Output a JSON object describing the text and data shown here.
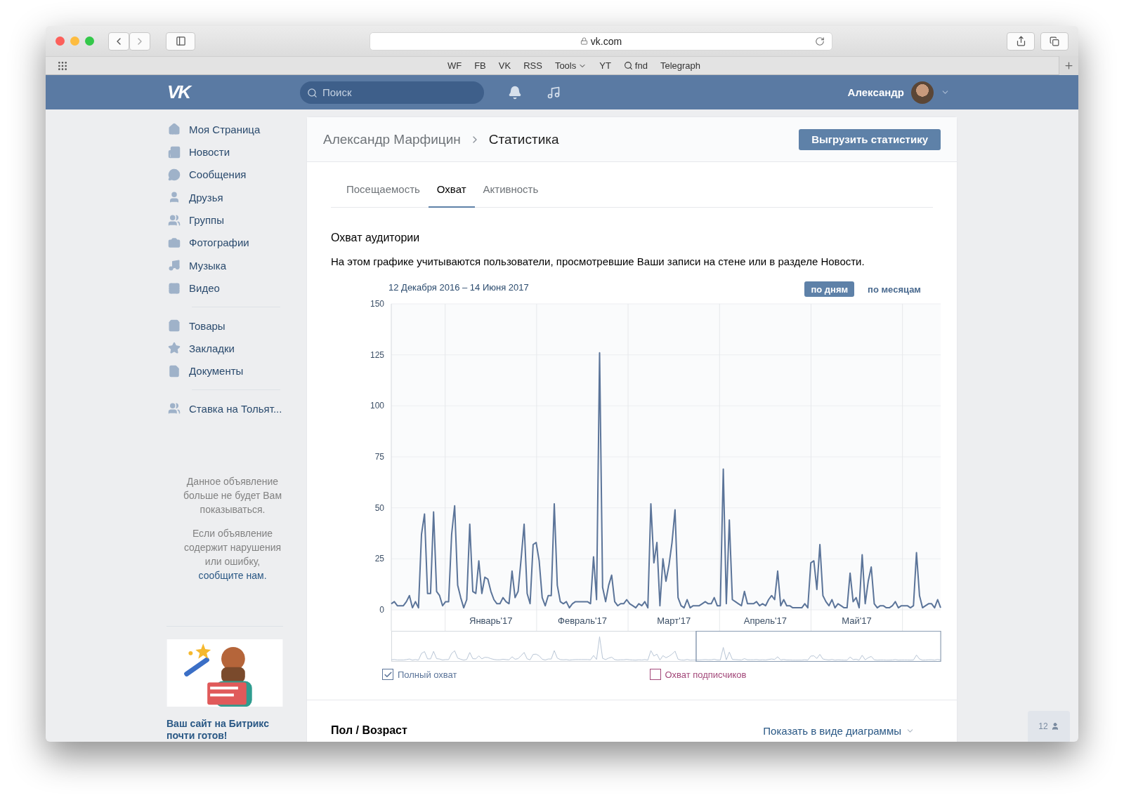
{
  "browser": {
    "address": "vk.com",
    "bookmarks": [
      "WF",
      "FB",
      "VK",
      "RSS",
      "Tools",
      "YT",
      "fnd",
      "Telegraph"
    ]
  },
  "header": {
    "logo": "VK",
    "search": {
      "placeholder": "Поиск"
    },
    "user": "Александр"
  },
  "sidebar": {
    "groups": [
      [
        "Моя Страница",
        "Новости",
        "Сообщения",
        "Друзья",
        "Группы",
        "Фотографии",
        "Музыка",
        "Видео"
      ],
      [
        "Товары",
        "Закладки",
        "Документы"
      ],
      [
        "Ставка на Тольят..."
      ]
    ],
    "notice": [
      "Данное объявление больше не будет Вам показываться.",
      "Если объявление содержит нарушения или ошибку, "
    ],
    "notice_link": "сообщите нам.",
    "ad_title": "Ваш сайт на Битрикс почти готов!"
  },
  "breadcrumb": {
    "parent": "Александр Марфицин",
    "current": "Статистика"
  },
  "export_button": "Выгрузить статистику",
  "tabs": [
    {
      "label": "Посещаемость",
      "selected": false
    },
    {
      "label": "Охват",
      "selected": true
    },
    {
      "label": "Активность",
      "selected": false
    }
  ],
  "section": {
    "title": "Охват аудитории",
    "description": "На этом графике учитываются пользователи, просмотревшие Ваши записи на стене или в разделе Новости.",
    "period": "12 Декабря 2016 – 14 Июня 2017",
    "modes": [
      {
        "label": "по дням",
        "selected": true
      },
      {
        "label": "по месяцам",
        "selected": false
      }
    ],
    "month_labels": [
      "Январь'17",
      "Февраль'17",
      "Март'17",
      "Апрель'17",
      "Май'17"
    ],
    "chart_data": {
      "type": "line",
      "grid": true,
      "ylim": [
        0,
        150
      ],
      "yticks": [
        0,
        25,
        50,
        75,
        100,
        125,
        150
      ],
      "series": [
        {
          "name": "Полный охват",
          "color": "#5b7499",
          "values": [
            3,
            4,
            2,
            2,
            2,
            4,
            7,
            1,
            4,
            1,
            37,
            47,
            8,
            8,
            48,
            9,
            7,
            2,
            4,
            4,
            37,
            51,
            12,
            6,
            1,
            5,
            42,
            9,
            8,
            24,
            8,
            16,
            15,
            9,
            5,
            3,
            3,
            6,
            4,
            3,
            19,
            6,
            9,
            25,
            42,
            8,
            3,
            32,
            33,
            24,
            6,
            2,
            7,
            7,
            52,
            12,
            4,
            3,
            4,
            1,
            3,
            4,
            4,
            4,
            4,
            4,
            3,
            26,
            5,
            126,
            11,
            4,
            12,
            17,
            4,
            2,
            3,
            3,
            5,
            3,
            2,
            1,
            3,
            2,
            4,
            1,
            52,
            23,
            33,
            2,
            25,
            14,
            22,
            33,
            49,
            6,
            2,
            1,
            5,
            1,
            2,
            2,
            2,
            3,
            4,
            3,
            3,
            6,
            2,
            2,
            69,
            3,
            44,
            5,
            4,
            3,
            2,
            9,
            3,
            3,
            3,
            4,
            2,
            3,
            2,
            5,
            7,
            5,
            19,
            2,
            5,
            2,
            2,
            1,
            1,
            1,
            1,
            3,
            1,
            23,
            24,
            10,
            32,
            7,
            4,
            2,
            5,
            1,
            3,
            2,
            1,
            1,
            18,
            4,
            6,
            1,
            27,
            3,
            14,
            21,
            3,
            1,
            2,
            2,
            1,
            1,
            2,
            4,
            1,
            2,
            2,
            2,
            1,
            2,
            28,
            7,
            1,
            2,
            3,
            3,
            1,
            5,
            1
          ]
        }
      ]
    },
    "legend": [
      {
        "checked": true
      },
      {
        "label": "Охват подписчиков",
        "checked": false,
        "color": "#a3497a"
      }
    ]
  },
  "next_section": {
    "title": "Пол / Возраст",
    "view_link": "Показать в виде диаграммы"
  },
  "online_widget": "12"
}
